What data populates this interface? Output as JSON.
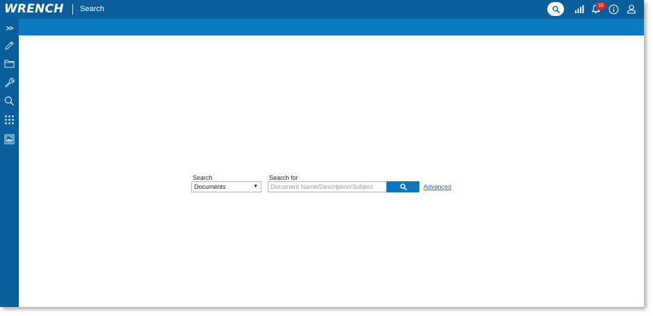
{
  "header": {
    "logo_text": "WRENCH",
    "module_title": "Search",
    "notification_count": "10",
    "icons": [
      "search-icon",
      "signal-bars-icon",
      "bell-icon",
      "info-icon",
      "user-icon"
    ]
  },
  "sidebar": {
    "expand_label": ">>",
    "items": [
      {
        "icon": "pencil-icon"
      },
      {
        "icon": "folder-icon"
      },
      {
        "icon": "wrench-icon"
      },
      {
        "icon": "search-icon"
      },
      {
        "icon": "apps-grid-icon"
      },
      {
        "icon": "image-gallery-icon"
      }
    ]
  },
  "search_form": {
    "search_label": "Search",
    "search_type_value": "Documents",
    "search_for_label": "Search for",
    "search_for_placeholder": "Document Name/Description/Subject",
    "search_for_value": "",
    "advanced_link": "Advanced"
  },
  "colors": {
    "header_bg": "#0a5e9c",
    "subbar_bg": "#0a7bc2",
    "button_bg": "#0a76bd",
    "badge_bg": "#d9232d",
    "link": "#1d6fd1"
  }
}
